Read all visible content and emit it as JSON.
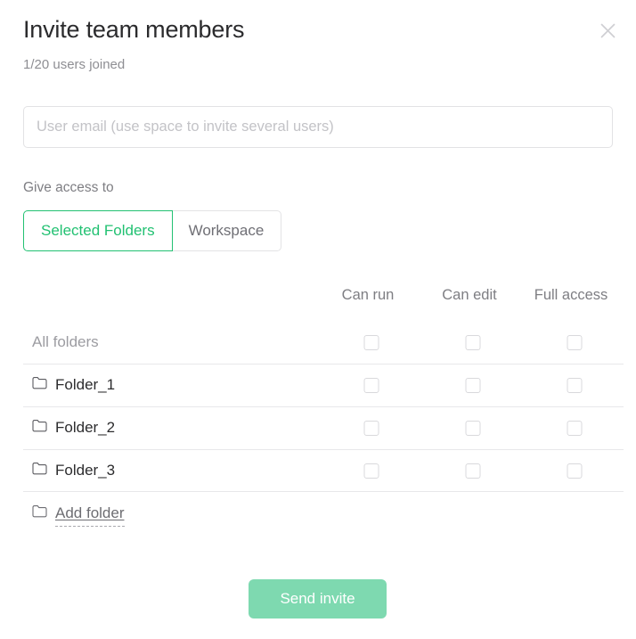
{
  "dialog": {
    "title": "Invite team members",
    "subtitle": "1/20 users joined",
    "close_label": "×"
  },
  "email_field": {
    "placeholder": "User email (use space to invite several users)",
    "value": ""
  },
  "access": {
    "label": "Give access to",
    "tabs": [
      {
        "label": "Selected Folders",
        "active": true
      },
      {
        "label": "Workspace",
        "active": false
      }
    ]
  },
  "permissions": {
    "columns": [
      "Can run",
      "Can edit",
      "Full access"
    ],
    "rows": [
      {
        "label": "All folders",
        "has_folder_icon": false,
        "checks": [
          false,
          false,
          false
        ]
      },
      {
        "label": "Folder_1",
        "has_folder_icon": true,
        "checks": [
          false,
          false,
          false
        ]
      },
      {
        "label": "Folder_2",
        "has_folder_icon": true,
        "checks": [
          false,
          false,
          false
        ]
      },
      {
        "label": "Folder_3",
        "has_folder_icon": true,
        "checks": [
          false,
          false,
          false
        ]
      }
    ],
    "add_folder_label": "Add folder"
  },
  "footer": {
    "send_label": "Send invite"
  },
  "colors": {
    "accent_green": "#22c172",
    "button_green": "#7ed9b0",
    "text_dark": "#2c2c2e",
    "text_muted": "#8e8e93",
    "border_light": "#e2e2e4",
    "separator": "#e8e8ea"
  }
}
